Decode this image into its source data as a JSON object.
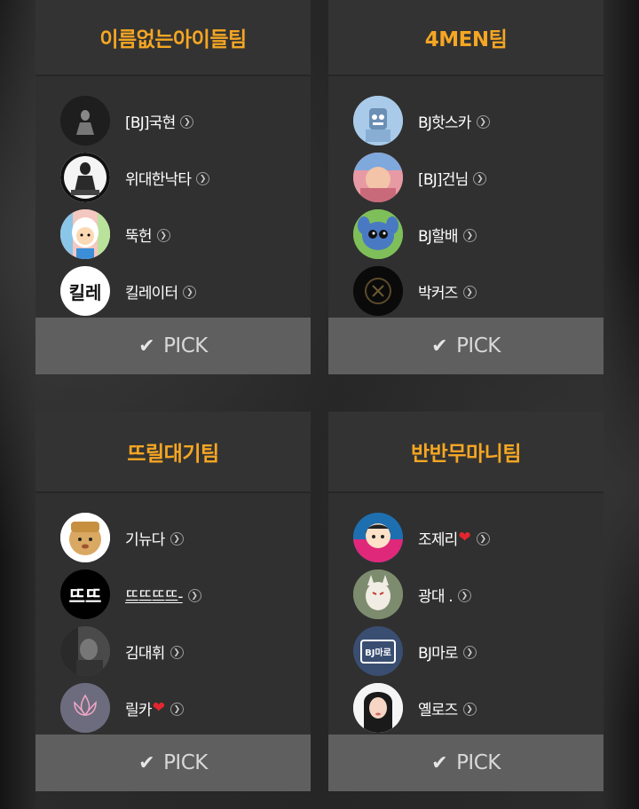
{
  "teams": [
    {
      "name": "이름없는아이들팀",
      "pick_label": "PICK",
      "members": [
        {
          "name": "[BJ]국현",
          "heart": false,
          "avatar_icon": "dark-figure-avatar"
        },
        {
          "name": "위대한낙타",
          "heart": false,
          "avatar_icon": "sketch-figure-avatar"
        },
        {
          "name": "뚝헌",
          "heart": false,
          "avatar_icon": "cartoon-character-avatar"
        },
        {
          "name": "킬레이터",
          "heart": false,
          "avatar_icon": "calligraphy-logo-avatar"
        }
      ]
    },
    {
      "name": "4MEN팀",
      "pick_label": "PICK",
      "members": [
        {
          "name": "BJ핫스카",
          "heart": false,
          "avatar_icon": "robot-character-avatar"
        },
        {
          "name": "[BJ]건님",
          "heart": false,
          "avatar_icon": "photo-avatar"
        },
        {
          "name": "BJ할배",
          "heart": false,
          "avatar_icon": "blue-creature-avatar"
        },
        {
          "name": "박커즈",
          "heart": false,
          "avatar_icon": "dark-emblem-avatar"
        }
      ]
    },
    {
      "name": "뜨릴대기팀",
      "pick_label": "PICK",
      "members": [
        {
          "name": "기뉴다",
          "heart": false,
          "avatar_icon": "bear-face-avatar"
        },
        {
          "name": "뜨뜨뜨뜨-",
          "heart": false,
          "avatar_icon": "text-logo-avatar",
          "underline": true
        },
        {
          "name": "김대휘",
          "heart": false,
          "avatar_icon": "grayscale-photo-avatar"
        },
        {
          "name": "릴카",
          "heart": true,
          "avatar_icon": "lotus-logo-avatar"
        }
      ]
    },
    {
      "name": "반반무마니팀",
      "pick_label": "PICK",
      "members": [
        {
          "name": "조제리",
          "heart": true,
          "avatar_icon": "cartoon-girl-avatar"
        },
        {
          "name": "광대 .",
          "heart": false,
          "avatar_icon": "fox-mask-avatar"
        },
        {
          "name": "BJ마로",
          "heart": false,
          "avatar_icon": "tv-logo-avatar"
        },
        {
          "name": "옐로즈",
          "heart": false,
          "avatar_icon": "portrait-photo-avatar"
        }
      ]
    }
  ],
  "avatar_texts": {
    "tv_logo": "BJ마로",
    "text_logo": "뜨뜨",
    "calligraphy": "킬레"
  },
  "icons": {
    "pick": "checkmark-icon",
    "detail": "chevron-right-circle-icon",
    "heart": "heart-icon"
  },
  "colors": {
    "accent": "#f5a623",
    "pick_bg": "#5f5f5f",
    "card_bg": "#303030",
    "heart": "#e3262e"
  }
}
